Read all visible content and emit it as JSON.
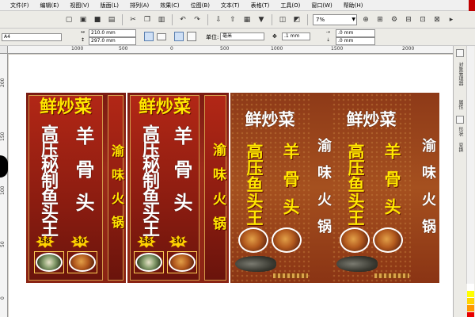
{
  "menu": [
    "文件(F)",
    "编辑(E)",
    "视图(V)",
    "版面(L)",
    "排列(A)",
    "效果(C)",
    "位图(B)",
    "文本(T)",
    "表格(T)",
    "工具(O)",
    "窗口(W)",
    "帮助(H)"
  ],
  "toolbar": {
    "zoom_value": "7%"
  },
  "propbar": {
    "page_size": "A4",
    "width": "210.0 mm",
    "height": "297.0 mm",
    "units_label": "单位:",
    "units_value": "毫米",
    "nudge_value": ".1 mm",
    "dup_x": ".0 mm",
    "dup_y": ".0 mm"
  },
  "ruler_top": [
    "1000",
    "500",
    "0",
    "500",
    "1000",
    "1500",
    "2000"
  ],
  "ruler_left": [
    "200",
    "150",
    "100",
    "50",
    "0"
  ],
  "docker_tabs": [
    "对象管理器",
    "属性",
    "形状",
    "变换"
  ],
  "palette_colors": [
    "#ffffff",
    "#ffff00",
    "#ffd400",
    "#ff9900",
    "#e80000",
    "#000000"
  ],
  "posters": {
    "p1": {
      "title": "鲜炒菜",
      "left_col": "高压秘制鱼头王",
      "right_col": "羊骨头",
      "price1": "58",
      "price2": "30",
      "side": "渝味火锅"
    },
    "p2": {
      "title": "鲜炒菜",
      "left_col": "高压秘制鱼头王",
      "right_col": "羊骨头",
      "price1": "58",
      "price2": "30",
      "side": "渝味火锅"
    },
    "p3": {
      "title": "鲜炒菜",
      "left_col": "高压鱼头王",
      "right_col": "羊骨头",
      "side": "渝味火锅"
    },
    "p4": {
      "title": "鲜炒菜",
      "left_col": "高压鱼头王",
      "right_col": "羊骨头",
      "side": "渝味火锅"
    }
  }
}
